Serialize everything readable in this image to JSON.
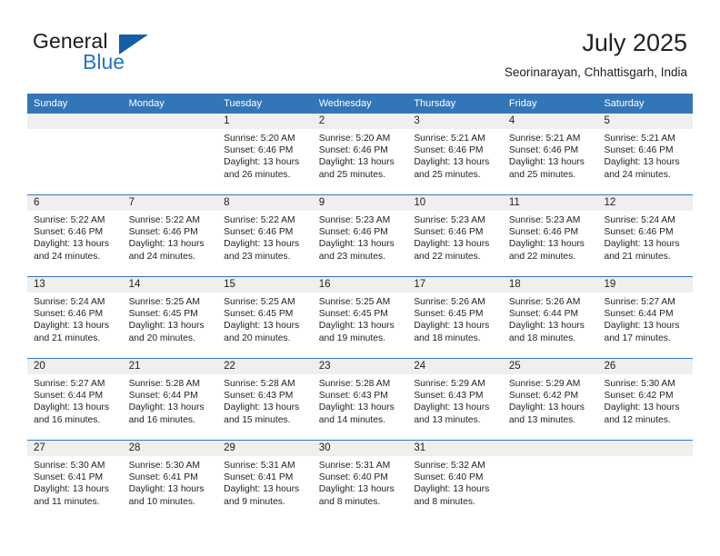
{
  "brand": {
    "name_part1": "General",
    "name_part2": "Blue"
  },
  "header": {
    "title": "July 2025",
    "subtitle": "Seorinarayan, Chhattisgarh, India"
  },
  "colors": {
    "header_blue": "#3276b8",
    "brand_blue": "#2277c0",
    "daynum_band": "#efefef",
    "text": "#232323"
  },
  "weekdays": [
    "Sunday",
    "Monday",
    "Tuesday",
    "Wednesday",
    "Thursday",
    "Friday",
    "Saturday"
  ],
  "weeks": [
    [
      {
        "day": "",
        "sunrise": "",
        "sunset": "",
        "daylight": "",
        "empty": true
      },
      {
        "day": "",
        "sunrise": "",
        "sunset": "",
        "daylight": "",
        "empty": true
      },
      {
        "day": "1",
        "sunrise": "Sunrise: 5:20 AM",
        "sunset": "Sunset: 6:46 PM",
        "daylight": "Daylight: 13 hours and 26 minutes."
      },
      {
        "day": "2",
        "sunrise": "Sunrise: 5:20 AM",
        "sunset": "Sunset: 6:46 PM",
        "daylight": "Daylight: 13 hours and 25 minutes."
      },
      {
        "day": "3",
        "sunrise": "Sunrise: 5:21 AM",
        "sunset": "Sunset: 6:46 PM",
        "daylight": "Daylight: 13 hours and 25 minutes."
      },
      {
        "day": "4",
        "sunrise": "Sunrise: 5:21 AM",
        "sunset": "Sunset: 6:46 PM",
        "daylight": "Daylight: 13 hours and 25 minutes."
      },
      {
        "day": "5",
        "sunrise": "Sunrise: 5:21 AM",
        "sunset": "Sunset: 6:46 PM",
        "daylight": "Daylight: 13 hours and 24 minutes."
      }
    ],
    [
      {
        "day": "6",
        "sunrise": "Sunrise: 5:22 AM",
        "sunset": "Sunset: 6:46 PM",
        "daylight": "Daylight: 13 hours and 24 minutes."
      },
      {
        "day": "7",
        "sunrise": "Sunrise: 5:22 AM",
        "sunset": "Sunset: 6:46 PM",
        "daylight": "Daylight: 13 hours and 24 minutes."
      },
      {
        "day": "8",
        "sunrise": "Sunrise: 5:22 AM",
        "sunset": "Sunset: 6:46 PM",
        "daylight": "Daylight: 13 hours and 23 minutes."
      },
      {
        "day": "9",
        "sunrise": "Sunrise: 5:23 AM",
        "sunset": "Sunset: 6:46 PM",
        "daylight": "Daylight: 13 hours and 23 minutes."
      },
      {
        "day": "10",
        "sunrise": "Sunrise: 5:23 AM",
        "sunset": "Sunset: 6:46 PM",
        "daylight": "Daylight: 13 hours and 22 minutes."
      },
      {
        "day": "11",
        "sunrise": "Sunrise: 5:23 AM",
        "sunset": "Sunset: 6:46 PM",
        "daylight": "Daylight: 13 hours and 22 minutes."
      },
      {
        "day": "12",
        "sunrise": "Sunrise: 5:24 AM",
        "sunset": "Sunset: 6:46 PM",
        "daylight": "Daylight: 13 hours and 21 minutes."
      }
    ],
    [
      {
        "day": "13",
        "sunrise": "Sunrise: 5:24 AM",
        "sunset": "Sunset: 6:46 PM",
        "daylight": "Daylight: 13 hours and 21 minutes."
      },
      {
        "day": "14",
        "sunrise": "Sunrise: 5:25 AM",
        "sunset": "Sunset: 6:45 PM",
        "daylight": "Daylight: 13 hours and 20 minutes."
      },
      {
        "day": "15",
        "sunrise": "Sunrise: 5:25 AM",
        "sunset": "Sunset: 6:45 PM",
        "daylight": "Daylight: 13 hours and 20 minutes."
      },
      {
        "day": "16",
        "sunrise": "Sunrise: 5:25 AM",
        "sunset": "Sunset: 6:45 PM",
        "daylight": "Daylight: 13 hours and 19 minutes."
      },
      {
        "day": "17",
        "sunrise": "Sunrise: 5:26 AM",
        "sunset": "Sunset: 6:45 PM",
        "daylight": "Daylight: 13 hours and 18 minutes."
      },
      {
        "day": "18",
        "sunrise": "Sunrise: 5:26 AM",
        "sunset": "Sunset: 6:44 PM",
        "daylight": "Daylight: 13 hours and 18 minutes."
      },
      {
        "day": "19",
        "sunrise": "Sunrise: 5:27 AM",
        "sunset": "Sunset: 6:44 PM",
        "daylight": "Daylight: 13 hours and 17 minutes."
      }
    ],
    [
      {
        "day": "20",
        "sunrise": "Sunrise: 5:27 AM",
        "sunset": "Sunset: 6:44 PM",
        "daylight": "Daylight: 13 hours and 16 minutes."
      },
      {
        "day": "21",
        "sunrise": "Sunrise: 5:28 AM",
        "sunset": "Sunset: 6:44 PM",
        "daylight": "Daylight: 13 hours and 16 minutes."
      },
      {
        "day": "22",
        "sunrise": "Sunrise: 5:28 AM",
        "sunset": "Sunset: 6:43 PM",
        "daylight": "Daylight: 13 hours and 15 minutes."
      },
      {
        "day": "23",
        "sunrise": "Sunrise: 5:28 AM",
        "sunset": "Sunset: 6:43 PM",
        "daylight": "Daylight: 13 hours and 14 minutes."
      },
      {
        "day": "24",
        "sunrise": "Sunrise: 5:29 AM",
        "sunset": "Sunset: 6:43 PM",
        "daylight": "Daylight: 13 hours and 13 minutes."
      },
      {
        "day": "25",
        "sunrise": "Sunrise: 5:29 AM",
        "sunset": "Sunset: 6:42 PM",
        "daylight": "Daylight: 13 hours and 13 minutes."
      },
      {
        "day": "26",
        "sunrise": "Sunrise: 5:30 AM",
        "sunset": "Sunset: 6:42 PM",
        "daylight": "Daylight: 13 hours and 12 minutes."
      }
    ],
    [
      {
        "day": "27",
        "sunrise": "Sunrise: 5:30 AM",
        "sunset": "Sunset: 6:41 PM",
        "daylight": "Daylight: 13 hours and 11 minutes."
      },
      {
        "day": "28",
        "sunrise": "Sunrise: 5:30 AM",
        "sunset": "Sunset: 6:41 PM",
        "daylight": "Daylight: 13 hours and 10 minutes."
      },
      {
        "day": "29",
        "sunrise": "Sunrise: 5:31 AM",
        "sunset": "Sunset: 6:41 PM",
        "daylight": "Daylight: 13 hours and 9 minutes."
      },
      {
        "day": "30",
        "sunrise": "Sunrise: 5:31 AM",
        "sunset": "Sunset: 6:40 PM",
        "daylight": "Daylight: 13 hours and 8 minutes."
      },
      {
        "day": "31",
        "sunrise": "Sunrise: 5:32 AM",
        "sunset": "Sunset: 6:40 PM",
        "daylight": "Daylight: 13 hours and 8 minutes."
      },
      {
        "day": "",
        "sunrise": "",
        "sunset": "",
        "daylight": "",
        "empty": true
      },
      {
        "day": "",
        "sunrise": "",
        "sunset": "",
        "daylight": "",
        "empty": true
      }
    ]
  ]
}
